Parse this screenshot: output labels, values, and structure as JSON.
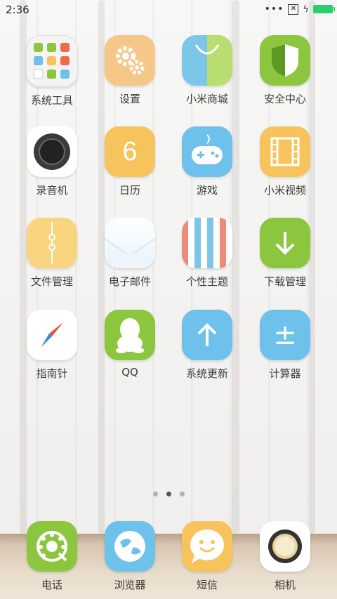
{
  "status": {
    "time": "2:36",
    "dots": "•••"
  },
  "apps": [
    {
      "label": "系统工具",
      "icon": "folder-icon",
      "color": "#f2f2f2"
    },
    {
      "label": "设置",
      "icon": "gear-icon",
      "color": "#f5c88a"
    },
    {
      "label": "小米商城",
      "icon": "shopping-bag-icon",
      "color": "#7cc6e8"
    },
    {
      "label": "安全中心",
      "icon": "shield-icon",
      "color": "#8cc63f"
    },
    {
      "label": "录音机",
      "icon": "recorder-icon",
      "color": "#ffffff"
    },
    {
      "label": "日历",
      "icon": "calendar-icon",
      "color": "#f7c35c",
      "text": "6"
    },
    {
      "label": "游戏",
      "icon": "gamepad-icon",
      "color": "#6ec1ea"
    },
    {
      "label": "小米视频",
      "icon": "film-icon",
      "color": "#f7c35c"
    },
    {
      "label": "文件管理",
      "icon": "file-folder-icon",
      "color": "#f9d57f"
    },
    {
      "label": "电子邮件",
      "icon": "envelope-icon",
      "color": "#ffffff"
    },
    {
      "label": "个性主题",
      "icon": "theme-stripes-icon",
      "color": "#ffffff"
    },
    {
      "label": "下载管理",
      "icon": "download-arrow-icon",
      "color": "#8cc63f"
    },
    {
      "label": "指南针",
      "icon": "compass-icon",
      "color": "#ffffff"
    },
    {
      "label": "QQ",
      "icon": "penguin-icon",
      "color": "#8cc63f"
    },
    {
      "label": "系统更新",
      "icon": "update-arrow-icon",
      "color": "#6ec1ea"
    },
    {
      "label": "计算器",
      "icon": "calculator-icon",
      "color": "#6ec1ea",
      "text": "±"
    }
  ],
  "dock": [
    {
      "label": "电话",
      "icon": "rotary-phone-icon",
      "color": "#8cc63f"
    },
    {
      "label": "浏览器",
      "icon": "globe-icon",
      "color": "#6ec1ea"
    },
    {
      "label": "短信",
      "icon": "smiley-message-icon",
      "color": "#f7c35c"
    },
    {
      "label": "相机",
      "icon": "camera-lens-icon",
      "color": "#ffffff"
    }
  ],
  "pager": {
    "count": 3,
    "active_index": 1
  }
}
